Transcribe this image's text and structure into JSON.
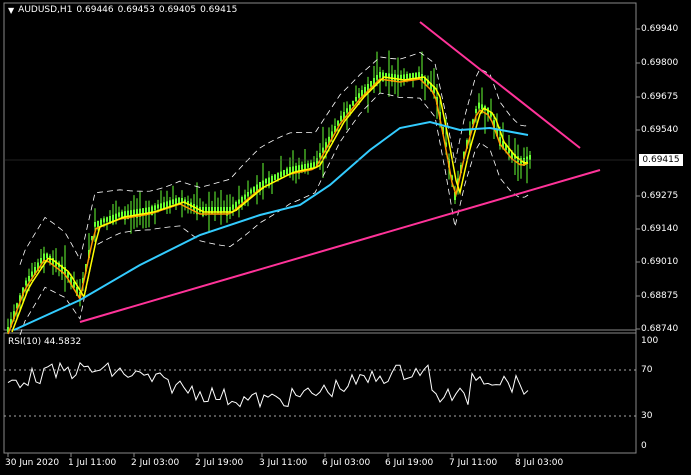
{
  "header": {
    "symbol_timeframe": "AUDUSD,H1",
    "open": "0.69446",
    "high": "0.69453",
    "low": "0.69405",
    "close": "0.69415",
    "collapse_glyph": "▼"
  },
  "price_axis": {
    "labels": [
      "0.69940",
      "0.69800",
      "0.69675",
      "0.69540",
      "0.69275",
      "0.69140",
      "0.69010",
      "0.68875",
      "0.68740"
    ],
    "current_price": "0.69415"
  },
  "rsi": {
    "title": "RSI(10) 44.5832",
    "levels": [
      "100",
      "70",
      "30",
      "0"
    ]
  },
  "time_axis": {
    "labels": [
      "30 Jun 2020",
      "1 Jul 11:00",
      "2 Jul 03:00",
      "2 Jul 19:00",
      "3 Jul 11:00",
      "6 Jul 03:00",
      "6 Jul 19:00",
      "7 Jul 11:00",
      "8 Jul 03:00"
    ]
  },
  "colors": {
    "background": "#000000",
    "candles": "#66ff33",
    "ma_fast": "#ff9900",
    "ma_mid": "#ffff00",
    "ma_slow": "#33ccff",
    "bands": "#ffffff",
    "trendlines": "#ff3399",
    "rsi_line": "#ffffff"
  }
}
